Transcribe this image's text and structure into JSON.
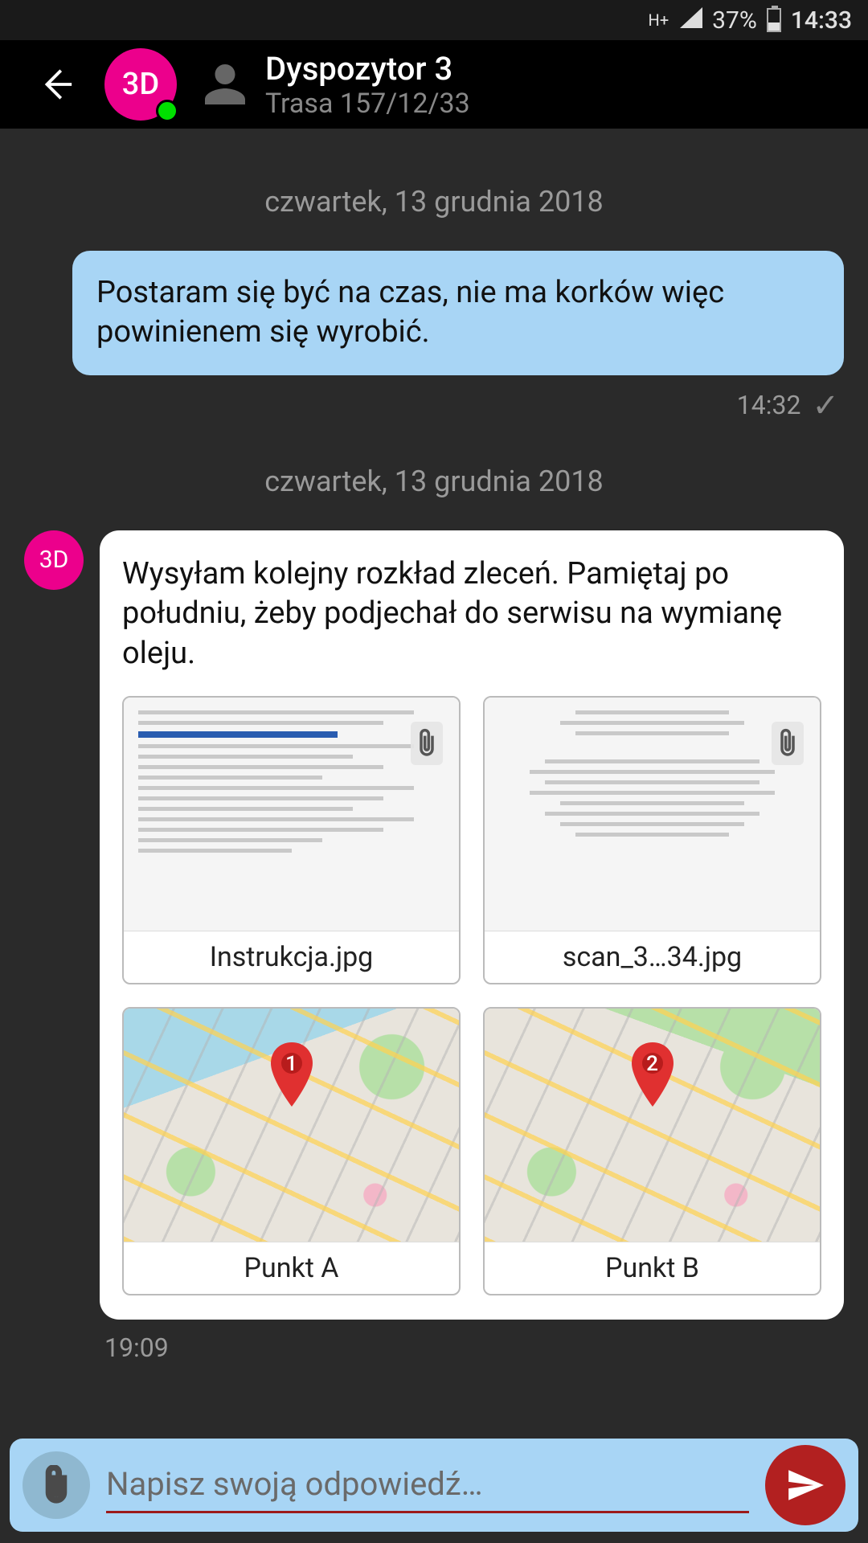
{
  "status": {
    "network": "H+",
    "battery_pct": "37%",
    "time": "14:33"
  },
  "header": {
    "avatar_initials": "3D",
    "title": "Dyspozytor 3",
    "subtitle": "Trasa 157/12/33"
  },
  "conversation": {
    "date1": "czwartek, 13 grudnia 2018",
    "outgoing1": {
      "text": "Postaram się być na czas, nie ma korków więc powinienem się wyrobić.",
      "time": "14:32"
    },
    "date2": "czwartek, 13 grudnia 2018",
    "incoming1": {
      "avatar_initials": "3D",
      "text": "Wysyłam kolejny rozkład zleceń. Pamiętaj po południu, żeby podjechał do serwisu na wymianę oleju.",
      "attachments": [
        {
          "caption": "Instrukcja.jpg",
          "kind": "doc",
          "pin": ""
        },
        {
          "caption": "scan_3…34.jpg",
          "kind": "doc",
          "pin": ""
        },
        {
          "caption": "Punkt A",
          "kind": "map",
          "pin": "1"
        },
        {
          "caption": "Punkt B",
          "kind": "map",
          "pin": "2"
        }
      ],
      "time": "19:09"
    }
  },
  "composer": {
    "placeholder": "Napisz swoją odpowiedź…"
  }
}
